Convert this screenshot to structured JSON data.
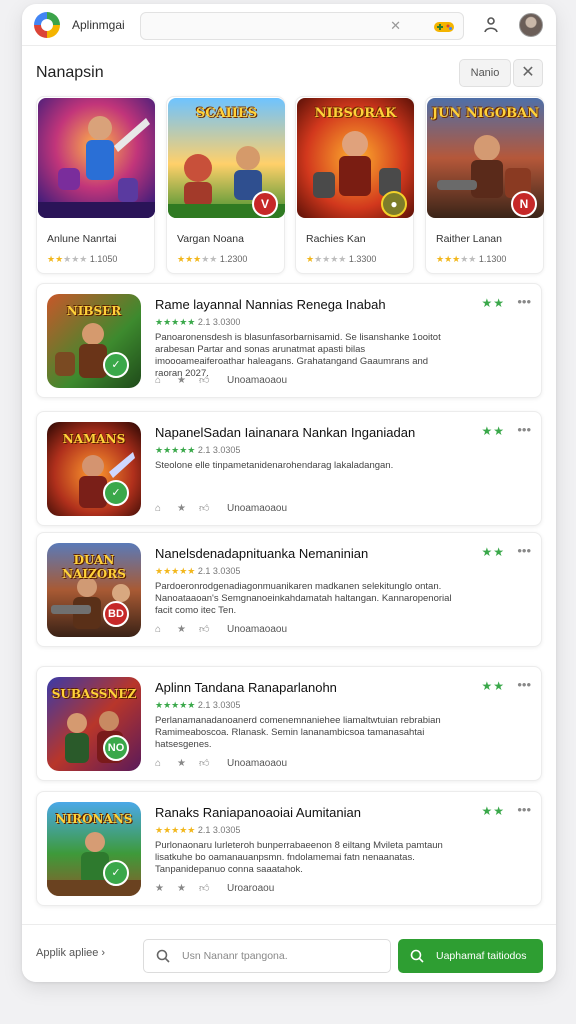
{
  "app": {
    "name": "Aplinmgai"
  },
  "header": {
    "title": "Nanapsin",
    "filter_label": "Nanio",
    "close_label": "✕"
  },
  "featured": [
    {
      "art_title": "",
      "name": "Anlune Nanrtai",
      "rating_text": "1.1050",
      "stars": 2,
      "badge": ""
    },
    {
      "art_title": "SCAIIES",
      "name": "Vargan Noana",
      "rating_text": "1.2300",
      "stars": 3,
      "badge": "V"
    },
    {
      "art_title": "NIBSORAK",
      "name": "Rachies Kan",
      "rating_text": "1.3300",
      "stars": 1,
      "badge": "●"
    },
    {
      "art_title": "JUN NIGOBAN",
      "name": "Raither Lanan",
      "rating_text": "1.1300",
      "stars": 3,
      "badge": "N"
    }
  ],
  "items": [
    {
      "thumb_title": "NIBSER",
      "title": "Rame layannal Nannias Renega Inabah",
      "rating_text": "2.1 3.0300",
      "desc": "Panoaronensdesh is blasunfasorbarnisamid. Se lisanshanke 1ooitot arabesan Partar and sonas arunatmat apasti bilas imoooameaiferoathar haleagans. Grahatangand Gaaumrans and raoran 2027.",
      "status": "Unoamaoaou",
      "badge": "✓",
      "badge_color": "#3aa84a"
    },
    {
      "thumb_title": "NAMANS",
      "title": "NapanelSadan Iainanara Nankan Inganiadan",
      "rating_text": "2.1 3.0305",
      "desc": "Steolone elle tinpametanidenarohendarag lakaladangan.",
      "status": "Unoamaoaou",
      "badge": "✓",
      "badge_color": "#3aa84a"
    },
    {
      "thumb_title": "DUAN NAIZORS",
      "title": "Nanelsdenadapnituanka Nemaninian",
      "rating_text": "2.1 3.0305",
      "desc": "Pardoeronrodgenadiagonmuanikaren madkanen selekitunglo ontan. Nanoataaoan's Semgnanoeinkahdamatah haltangan. Kannaropenorial facit como itec Ten.",
      "status": "Unoamaoaou",
      "badge": "BD",
      "badge_color": "#c62828"
    },
    {
      "thumb_title": "SUBASSNEZ",
      "title": "Aplinn Tandana Ranaparlanohn",
      "rating_text": "2.1 3.0305",
      "desc": "Perlanamanadanoanerd comenemnaniehee liamaltwtuian rebrabian Ramimeaboscoa. Rlanask. Semin lananambicsoa tamanasahtai hatsesgenes.",
      "status": "Unoamaoaou",
      "badge": "NO",
      "badge_color": "#3aa84a"
    },
    {
      "thumb_title": "NIRONANS",
      "title": "Ranaks Raniapanoaoiai Aumitanian",
      "rating_text": "2.1 3.0305",
      "desc": "Purlonaonaru lurleteroh bunperrabaeenon 8 eiltang Mvileta pamtaun lisatkuhe bo oamanauanpsmn. fndolamemai fatn nenaanatas. Tanpanidepanuo conna saaatahok.",
      "status": "Uroaroaou",
      "badge": "✓",
      "badge_color": "#3aa84a"
    }
  ],
  "bottom": {
    "back_label": "Applik apliee ›",
    "search_placeholder": "Usn Nananr tpangona.",
    "primary_label": "Uaphamaf taitiodos"
  }
}
